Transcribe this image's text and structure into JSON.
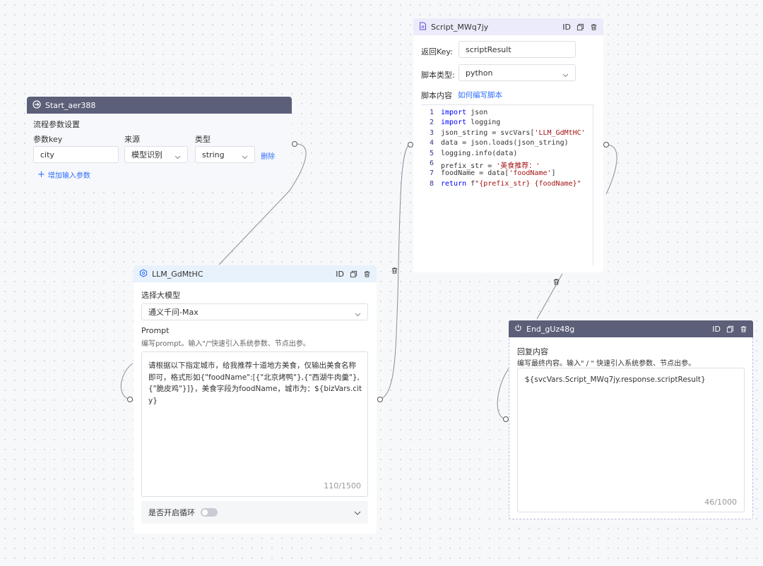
{
  "start_node": {
    "title": "Start_aer388",
    "section_label": "流程参数设置",
    "col_key": "参数key",
    "col_source": "来源",
    "col_type": "类型",
    "param_key_value": "city",
    "param_source_value": "模型识别",
    "param_type_value": "string",
    "delete_label": "删除",
    "add_param_label": "增加输入参数"
  },
  "llm_node": {
    "title": "LLM_GdMtHC",
    "id_label": "ID",
    "model_label": "选择大模型",
    "model_value": "通义千问-Max",
    "prompt_label": "Prompt",
    "prompt_hint": "编写prompt。输入\"/\"快速引入系统参数、节点出参。",
    "prompt_text": "请根据以下指定城市，给我推荐十道地方美食，仅输出美食名称即可，格式形如{\"foodName\":[{\"北京烤鸭\"},{\"西湖牛肉羹\"},{\"脆皮鸡\"}]}，美食字段为foodName，城市为：${bizVars.city}",
    "counter": "110/1500",
    "loop_label": "是否开启循环"
  },
  "script_node": {
    "title": "Script_MWq7jy",
    "id_label": "ID",
    "return_key_label": "返回Key:",
    "return_key_value": "scriptResult",
    "script_type_label": "脚本类型:",
    "script_type_value": "python",
    "script_content_label": "脚本内容",
    "how_to_link": "如何编写脚本",
    "code_lines": [
      {
        "num": "1",
        "kw": "import",
        "rest": " json",
        "str": "",
        "tail": ""
      },
      {
        "num": "2",
        "kw": "import",
        "rest": " logging",
        "str": "",
        "tail": ""
      },
      {
        "num": "3",
        "kw": "",
        "rest": "json_string = svcVars[",
        "str": "'LLM_GdMtHC'",
        "tail": ""
      },
      {
        "num": "4",
        "kw": "",
        "rest": "data = json.loads(json_string)",
        "str": "",
        "tail": ""
      },
      {
        "num": "5",
        "kw": "",
        "rest": "logging.info(data)",
        "str": "",
        "tail": ""
      },
      {
        "num": "6",
        "kw": "",
        "rest": "prefix_str = ",
        "str": "'美食推荐：'",
        "tail": ""
      },
      {
        "num": "7",
        "kw": "",
        "rest": "foodName = data[",
        "str": "'foodName'",
        "tail": "]"
      },
      {
        "num": "8",
        "kw": "return",
        "rest": " f",
        "str": "\"{prefix_str} {foodName}\"",
        "tail": ""
      }
    ]
  },
  "end_node": {
    "title": "End_gUz48g",
    "id_label": "ID",
    "reply_label": "回复内容",
    "reply_hint": "编写最终内容。输入\" / \" 快速引入系统参数、节点出参。",
    "reply_text": "${svcVars.Script_MWq7jy.response.scriptResult}",
    "counter": "46/1000"
  },
  "colors": {
    "dark_header": "#5b5f78",
    "llm_header": "#e8f2fd",
    "script_header": "#ecebfb",
    "accent": "#2f6fff"
  }
}
